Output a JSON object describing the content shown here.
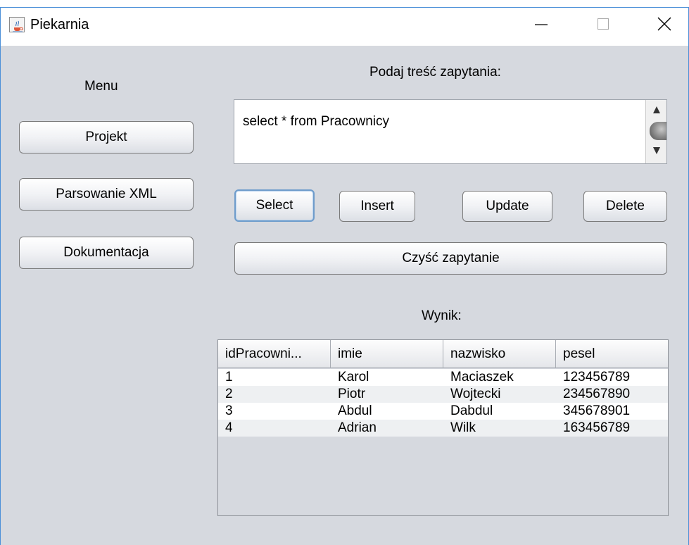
{
  "window": {
    "title": "Piekarnia"
  },
  "icons": {
    "app": "java-cup-icon",
    "minimize": "minimize-icon",
    "maximize": "maximize-icon",
    "close": "close-icon",
    "scroll_up": "arrow-up-icon",
    "scroll_down": "arrow-down-icon"
  },
  "menu": {
    "title": "Menu",
    "items": [
      "Projekt",
      "Parsowanie XML",
      "Dokumentacja"
    ]
  },
  "query": {
    "label": "Podaj treść zapytania:",
    "value": "select * from Pracownicy"
  },
  "actions": {
    "select": "Select",
    "insert": "Insert",
    "update": "Update",
    "delete": "Delete",
    "clear": "Czyść zapytanie"
  },
  "result": {
    "label": "Wynik:",
    "columns": [
      "idPracowni...",
      "imie",
      "nazwisko",
      "pesel"
    ],
    "rows": [
      [
        "1",
        "Karol",
        "Maciaszek",
        "123456789"
      ],
      [
        "2",
        "Piotr",
        "Wojtecki",
        "234567890"
      ],
      [
        "3",
        "Abdul",
        "Dabdul",
        "345678901"
      ],
      [
        "4",
        "Adrian",
        "Wilk",
        "163456789"
      ]
    ]
  },
  "colors": {
    "window_border": "#4a8fd8",
    "client_background": "#d6d9df",
    "focus_ring": "#6e9ccb"
  }
}
